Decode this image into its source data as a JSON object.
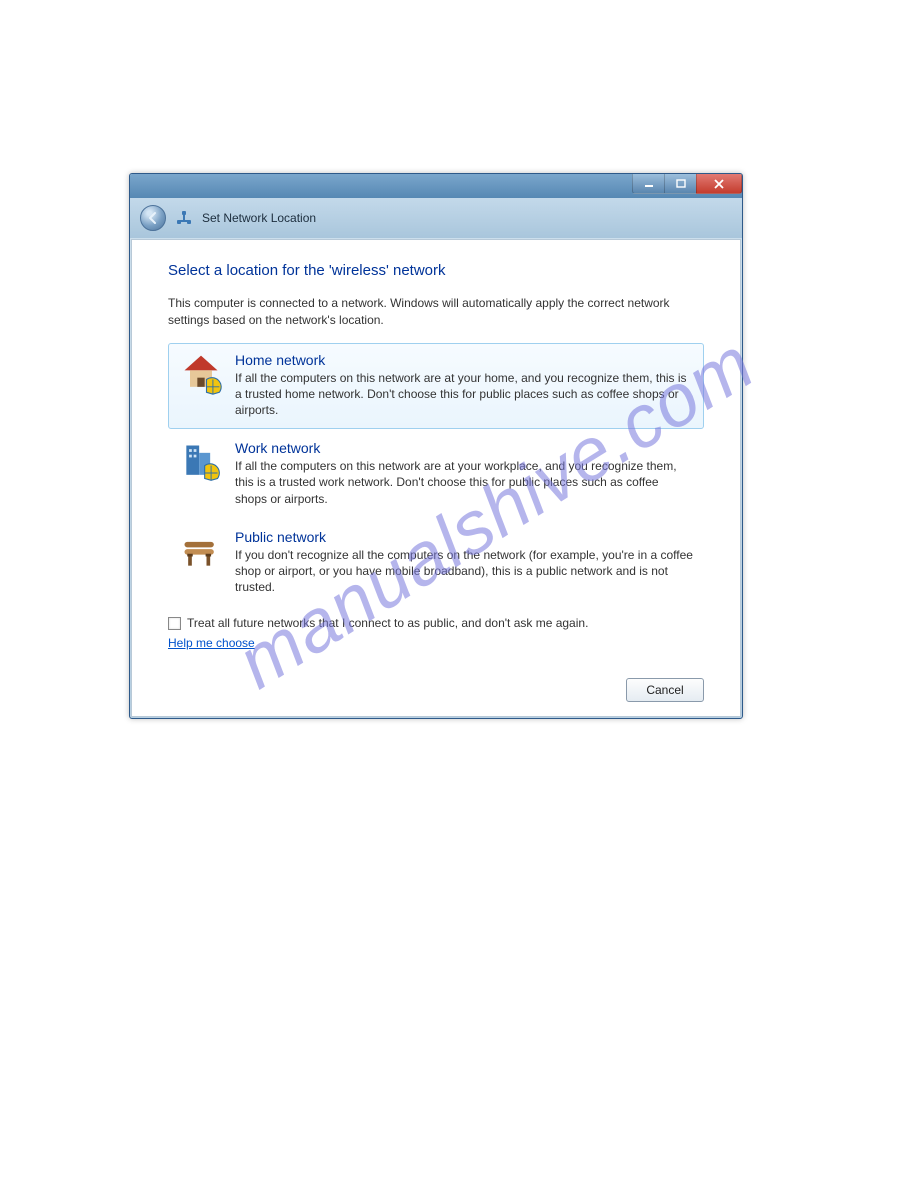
{
  "watermark": "manualshive.com",
  "header": {
    "title": "Set Network Location"
  },
  "content": {
    "heading": "Select a location for the 'wireless' network",
    "intro": "This computer is connected to a network. Windows will automatically apply the correct network settings based on the network's location.",
    "options": {
      "home": {
        "title": "Home network",
        "desc": "If all the computers on this network are at your home, and you recognize them, this is a trusted home network.  Don't choose this for public places such as coffee shops or airports."
      },
      "work": {
        "title": "Work network",
        "desc": "If all the computers on this network are at your workplace, and you recognize them, this is a trusted work network.  Don't choose this for public places such as coffee shops or airports."
      },
      "public": {
        "title": "Public network",
        "desc": "If you don't recognize all the computers on the network (for example, you're in a coffee shop or airport, or you have mobile broadband), this is a public network and is not trusted."
      }
    },
    "checkbox_label": "Treat all future networks that I connect to as public, and don't ask me again.",
    "help_link": "Help me choose"
  },
  "footer": {
    "cancel": "Cancel"
  }
}
